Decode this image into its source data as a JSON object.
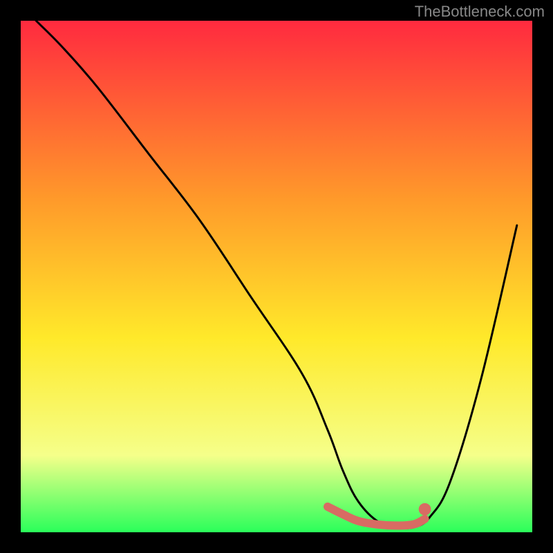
{
  "watermark": "TheBottleneck.com",
  "chart_data": {
    "type": "line",
    "title": "",
    "xlabel": "",
    "ylabel": "",
    "xlim": [
      0,
      100
    ],
    "ylim": [
      0,
      100
    ],
    "gradient": {
      "top": "#ff2a3f",
      "upper_mid": "#ff9a2a",
      "mid": "#ffe92a",
      "lower_mid": "#f5ff8a",
      "bottom": "#2aff5a"
    },
    "series": [
      {
        "name": "curve",
        "stroke": "#000000",
        "x": [
          3,
          8,
          15,
          25,
          35,
          45,
          55,
          60,
          63,
          66,
          70,
          74,
          77,
          80,
          84,
          90,
          97
        ],
        "y": [
          100,
          95,
          87,
          74,
          61,
          46,
          31,
          20,
          12,
          6,
          2,
          1,
          1,
          3,
          10,
          30,
          60
        ]
      },
      {
        "name": "highlight",
        "stroke": "#d86b63",
        "x": [
          60,
          63,
          66,
          70,
          74,
          77,
          79
        ],
        "y": [
          5,
          3.5,
          2.2,
          1.5,
          1.3,
          1.6,
          2.6
        ]
      }
    ],
    "marker": {
      "name": "highlight-end-dot",
      "fill": "#d86b63",
      "x": 79,
      "y": 4.5,
      "r": 1.2
    }
  }
}
